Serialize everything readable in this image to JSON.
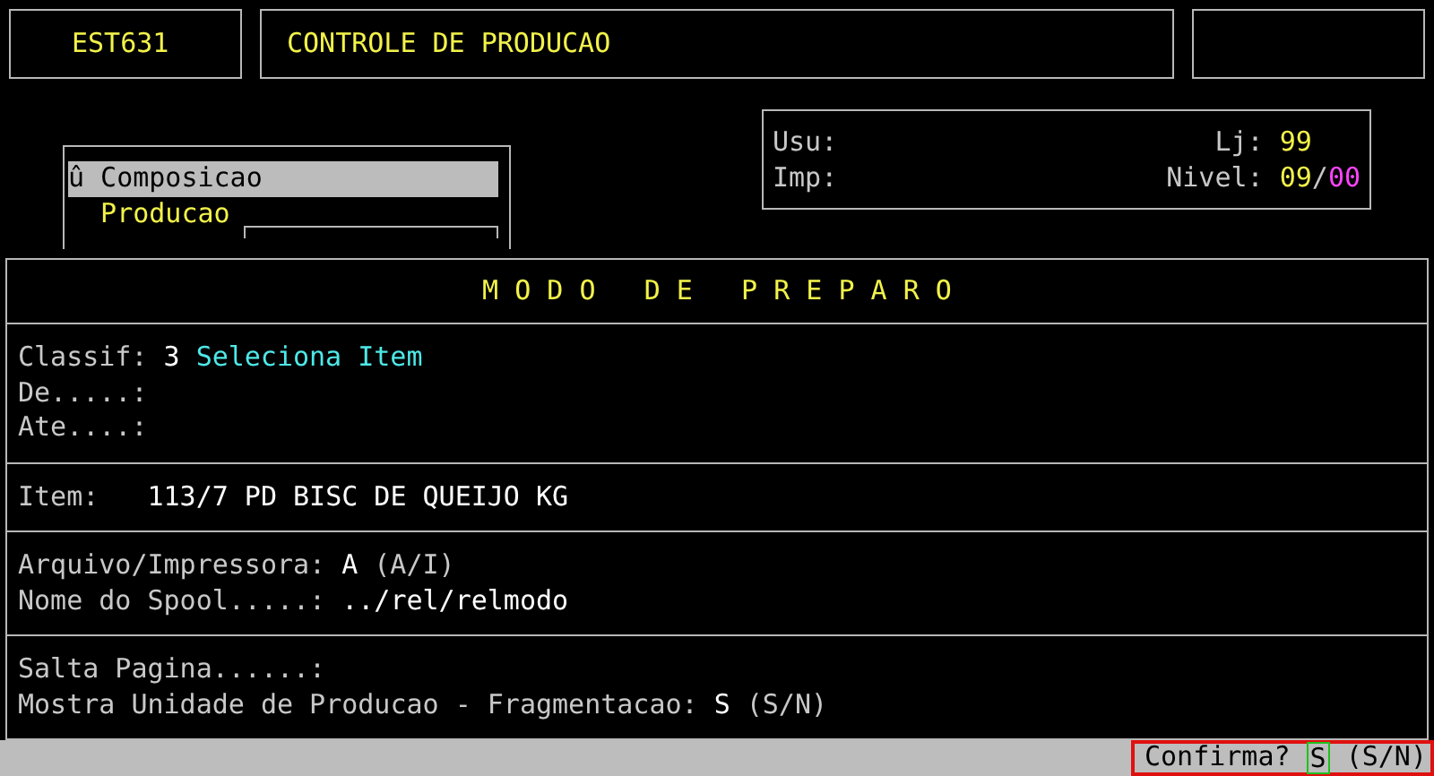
{
  "header": {
    "program": "EST631",
    "title": "CONTROLE DE PRODUCAO"
  },
  "menu": {
    "items": [
      {
        "label": "û Composicao",
        "selected": true
      },
      {
        "label": "Producao",
        "selected": false
      }
    ]
  },
  "info": {
    "user_label": "Usu:",
    "printer_label": "Imp:",
    "store_label": "Lj:",
    "store": "99",
    "level_label": "Nivel:",
    "level_major": "09",
    "level_separator": "/",
    "level_minor": "00"
  },
  "form": {
    "title": "M O D O   D E   P R E P A R O",
    "sections": [
      [
        {
          "kind": "plain",
          "label": "Classif:",
          "value": "3",
          "note": {
            "text": "Seleciona Item",
            "kind": "description"
          }
        },
        {
          "kind": "plain",
          "label": "De.....:"
        },
        {
          "kind": "plain",
          "label": "Ate....:"
        }
      ],
      [
        {
          "kind": "item",
          "label": "Item:",
          "value": "113/7 PD BISC DE QUEIJO KG"
        }
      ],
      [
        {
          "kind": "plain",
          "label": "Arquivo/Impressora:",
          "value": "A",
          "note": {
            "text": "(A/I)",
            "kind": "options"
          }
        },
        {
          "kind": "plain",
          "label": "Nome do Spool.....:",
          "value": "../rel/relmodo"
        }
      ],
      [
        {
          "kind": "plain",
          "label": "Salta Pagina......:"
        },
        {
          "kind": "plain",
          "label": "Mostra Unidade de Producao - Fragmentacao:",
          "value": "S",
          "note": {
            "text": "(S/N)",
            "kind": "options"
          }
        }
      ]
    ]
  },
  "status": {
    "prompt": "Confirma?",
    "answer": "S",
    "options": "(S/N)"
  }
}
